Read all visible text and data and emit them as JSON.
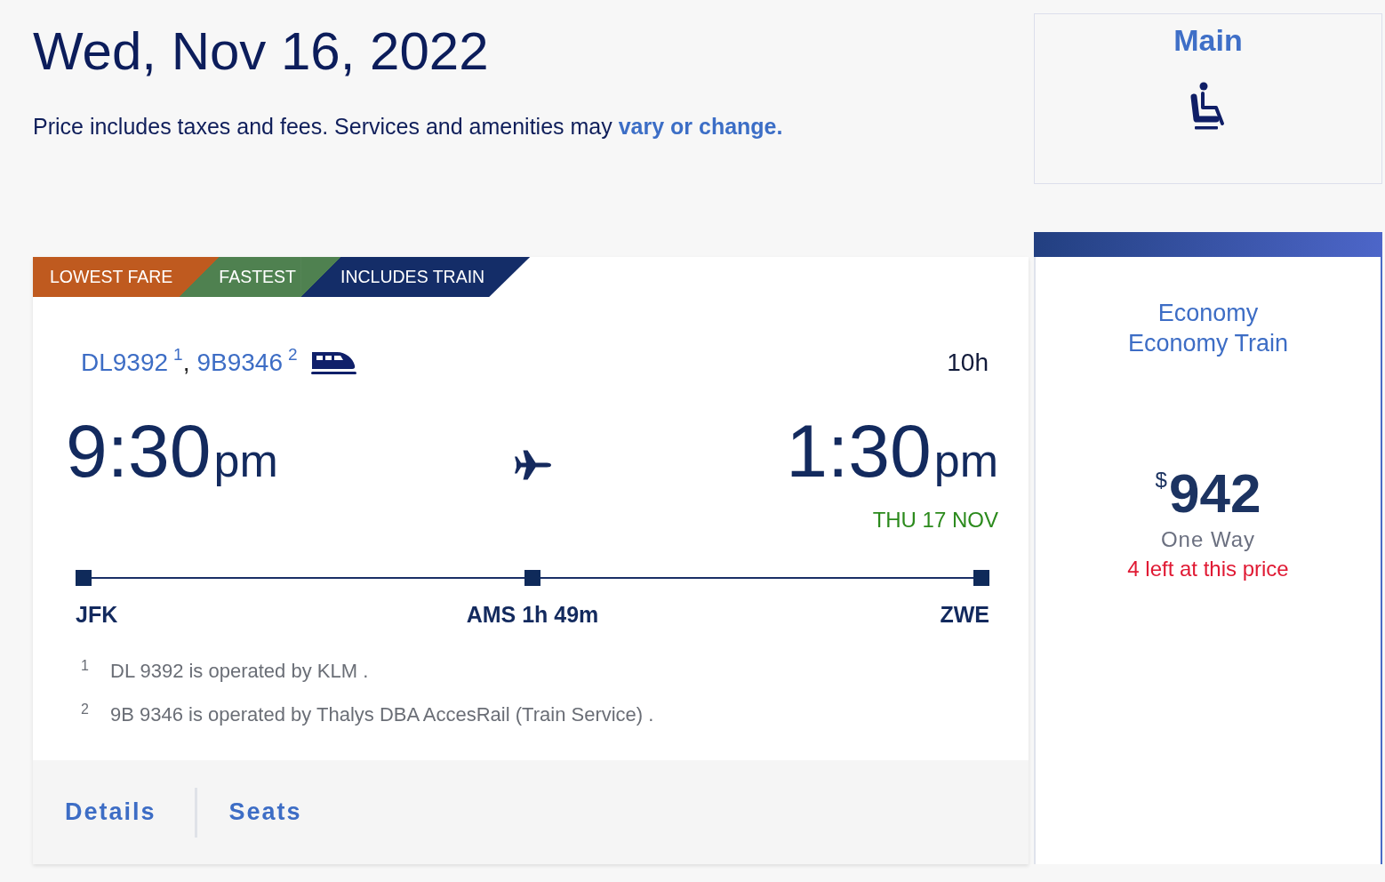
{
  "header": {
    "date": "Wed, Nov 16, 2022",
    "note": "Price includes taxes and fees. Services and amenities may",
    "note_link": "vary or change."
  },
  "cabin_header": {
    "title": "Main"
  },
  "flight": {
    "badges": [
      {
        "label": "LOWEST FARE",
        "color": "#bf5a1f"
      },
      {
        "label": "FASTEST",
        "color": "#4f8150"
      },
      {
        "label": "INCLUDES TRAIN",
        "color": "#142d68"
      }
    ],
    "flight_numbers": [
      {
        "number": "DL9392",
        "note_mark": "1"
      },
      {
        "number": "9B9346",
        "note_mark": "2"
      }
    ],
    "flight_number_separator": ",",
    "duration": "10h",
    "departure": {
      "time": "9:30",
      "period": "pm"
    },
    "arrival": {
      "time": "1:30",
      "period": "pm",
      "date": "THU 17 NOV"
    },
    "stops": [
      {
        "code": "JFK"
      },
      {
        "code": "AMS",
        "layover": "1h 49m"
      },
      {
        "code": "ZWE"
      }
    ],
    "footnotes": [
      {
        "mark": "1",
        "text": "DL 9392 is operated by KLM ."
      },
      {
        "mark": "2",
        "text": "9B 9346 is operated by Thalys DBA AccesRail (Train Service) ."
      }
    ],
    "actions": [
      "Details",
      "Seats"
    ]
  },
  "fare": {
    "cabins": [
      "Economy",
      "Economy Train"
    ],
    "currency": "$",
    "price": "942",
    "trip_type": "One Way",
    "availability": "4 left at this price"
  }
}
